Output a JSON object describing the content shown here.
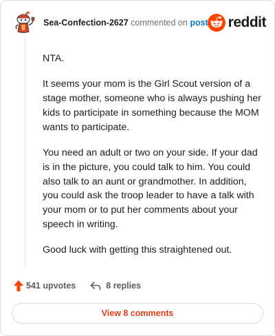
{
  "header": {
    "username": "Sea-Confection-2627",
    "commented_text": "commented on",
    "post_link": "post",
    "logo_text": "reddit"
  },
  "comment": {
    "paragraphs": [
      "NTA.",
      "It seems your mom is the Girl Scout version of a stage mother, someone who is always pushing her kids to participate in something because the MOM wants to participate.",
      "You need an adult or two on your side. If your dad is in the picture, you could talk to him. You could also talk to an aunt or grandmother. In addition, you could ask the troop leader to have a talk with your mom or to put her comments about your speech in writing.",
      "Good luck with getting this straightened out."
    ]
  },
  "actions": {
    "upvotes": "541 upvotes",
    "replies": "8 replies"
  },
  "footer": {
    "view_comments": "View 8 comments"
  },
  "colors": {
    "reddit_orange": "#ff4500",
    "link_blue": "#0a7ac9",
    "view_comments_red": "#e0401c"
  },
  "icons": {
    "avatar": "snoo-avatar-icon",
    "logo": "reddit-snoo-icon",
    "upvote": "upvote-arrow-icon",
    "reply": "reply-arrow-icon"
  }
}
